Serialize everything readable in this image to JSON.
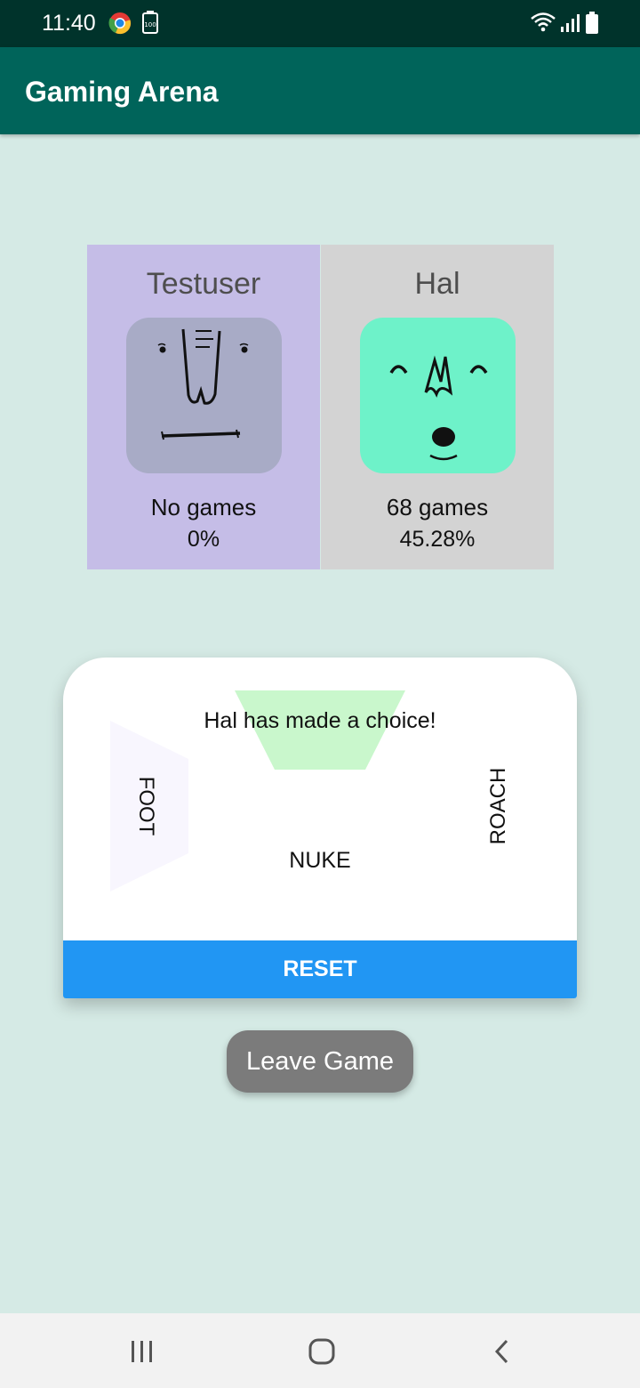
{
  "status_bar": {
    "time": "11:40",
    "icons": [
      "chrome-icon",
      "battery-saver-icon",
      "wifi-icon",
      "signal-icon",
      "battery-icon"
    ],
    "battery_small_text": "100"
  },
  "app_bar": {
    "title": "Gaming Arena"
  },
  "players": [
    {
      "name": "Testuser",
      "games": "No games",
      "win_rate": "0%",
      "color": "#c5bde7",
      "avatar_color": "#a8abc6"
    },
    {
      "name": "Hal",
      "games": "68 games",
      "win_rate": "45.28%",
      "color": "#d3d3d3",
      "avatar_color": "#6ef2c9"
    }
  ],
  "game": {
    "message": "Hal has made a choice!",
    "choices": {
      "left": "FOOT",
      "right": "ROACH",
      "bottom": "NUKE"
    },
    "reset_label": "RESET",
    "highlight_color": "#c9f7cc",
    "reset_color": "#2196f3"
  },
  "leave_label": "Leave Game",
  "nav_bar": {
    "icons": [
      "recents-icon",
      "home-icon",
      "back-icon"
    ]
  }
}
